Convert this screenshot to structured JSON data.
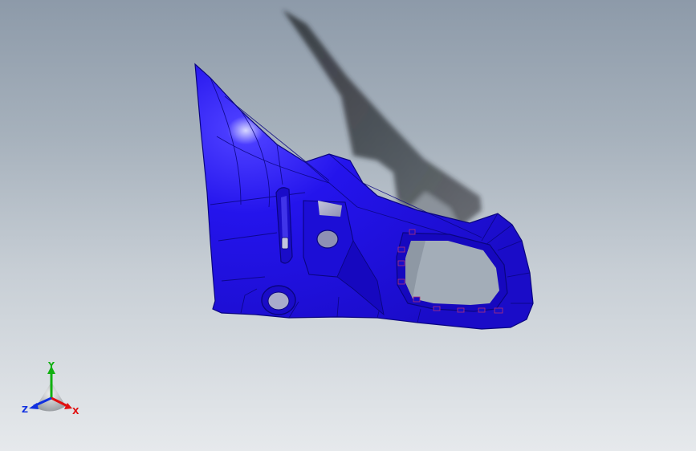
{
  "viewport": {
    "background_top": "#8d9aa9",
    "background_bottom": "#e6e9ec"
  },
  "part": {
    "color": "#1f10e8",
    "edge_color": "#0a0580",
    "accent_color": "#b0307a",
    "shadow_color": "#3a3d42"
  },
  "triad": {
    "x_label": "X",
    "y_label": "Y",
    "z_label": "Z",
    "x_color": "#e01010",
    "y_color": "#10b010",
    "z_color": "#1030e0",
    "icons": [
      "x-axis-arrow-icon",
      "y-axis-arrow-icon",
      "z-axis-arrow-icon"
    ]
  }
}
